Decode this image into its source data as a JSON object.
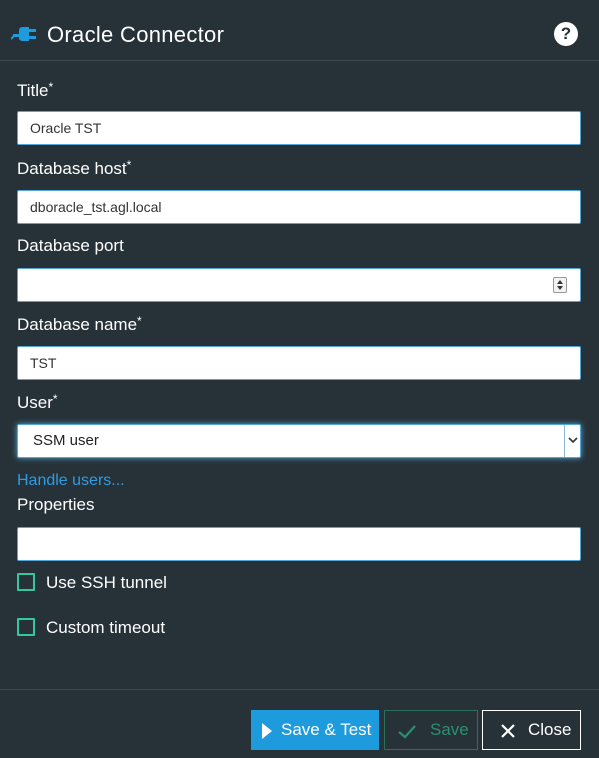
{
  "dialog": {
    "title": "Oracle Connector",
    "icons": {
      "header": "plug-icon",
      "help": "help-icon"
    },
    "help_glyph": "?"
  },
  "form": {
    "title": {
      "label": "Title",
      "required_mark": "*",
      "value": "Oracle TST"
    },
    "db_host": {
      "label": "Database host",
      "required_mark": "*",
      "value": "dboracle_tst.agl.local"
    },
    "db_port": {
      "label": "Database port",
      "value": ""
    },
    "db_name": {
      "label": "Database name",
      "required_mark": "*",
      "value": "TST"
    },
    "user": {
      "label": "User",
      "required_mark": "*",
      "selected": "SSM user"
    },
    "handle_users_link": "Handle users...",
    "properties": {
      "label": "Properties",
      "value": ""
    },
    "use_ssh_tunnel": {
      "label": "Use SSH tunnel",
      "checked": false
    },
    "custom_timeout": {
      "label": "Custom timeout",
      "checked": false
    }
  },
  "footer": {
    "save_test_label": "Save & Test",
    "save_label": "Save",
    "close_label": "Close"
  },
  "colors": {
    "background": "#273238",
    "accent": "#1e9bdc",
    "checkbox": "#37c7a0",
    "link": "#2f9be0"
  }
}
